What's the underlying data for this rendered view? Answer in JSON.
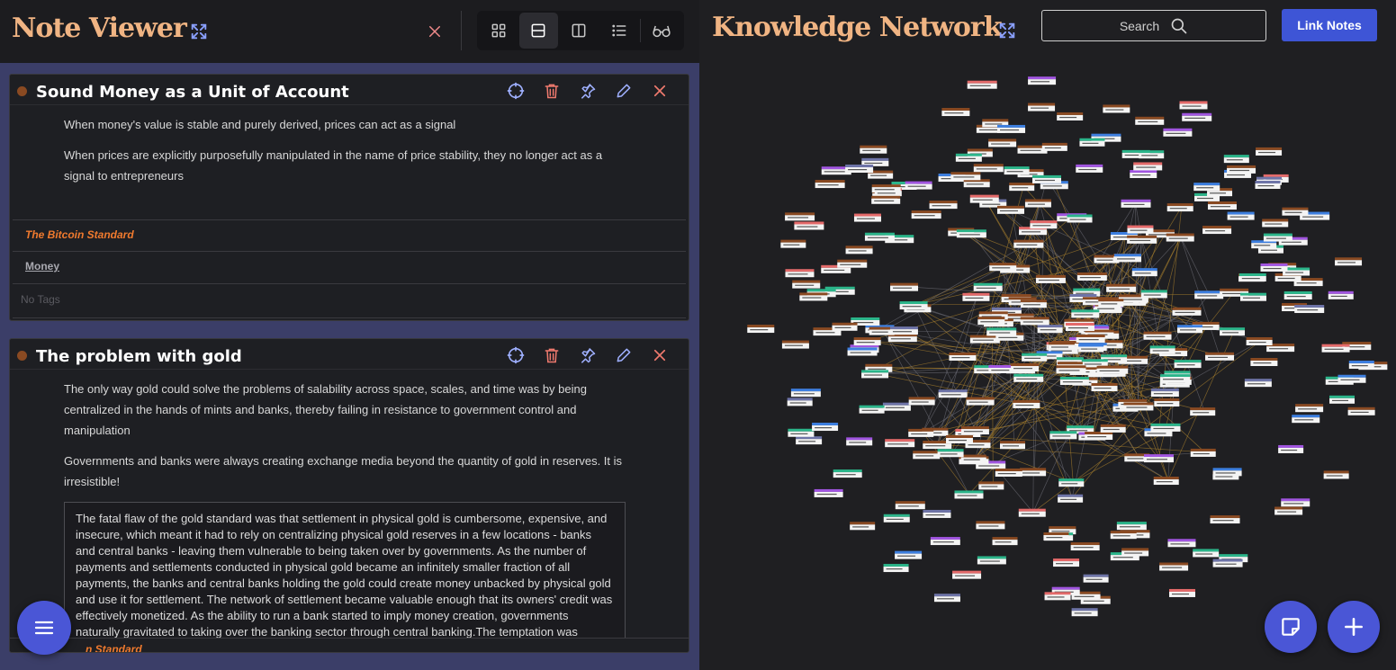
{
  "note_viewer": {
    "title": "Note Viewer",
    "view_modes": [
      "grid-view-icon",
      "stacked-view-icon",
      "split-view-icon",
      "list-view-icon",
      "reading-glasses-icon"
    ],
    "active_view": "stacked-view-icon"
  },
  "notes": [
    {
      "title": "Sound Money as a Unit of Account",
      "paragraphs": [
        "When money's value is stable and purely derived, prices can act as a signal",
        "When prices are explicitly purposefully manipulated in the name of price stability, they no longer act as a signal to entrepreneurs"
      ],
      "book": "The Bitcoin Standard",
      "topic": "Money",
      "tags": "No Tags"
    },
    {
      "title": "The problem with gold",
      "paragraphs": [
        "The only way gold could solve the problems of salability across space, scales, and time was by being centralized in the hands of mints and banks, thereby failing in resistance to government control and manipulation",
        "Governments and banks were always creating exchange media beyond the quantity of gold in reserves. It is irresistible!"
      ],
      "quote": "The fatal flaw of the gold standard was that settlement in physical gold is cumbersome, expensive, and insecure, which meant it had to rely on centralizing physical gold reserves in a few locations - banks and central banks - leaving them vulnerable to being taken over by governments. As the number of payments and settlements conducted in physical gold became an infinitely smaller fraction of all payments, the banks and central banks holding the gold could create money unbacked by physical gold and use it for settlement. The network of settlement became valuable enough that its owners' credit was effectively monetized. As the ability to run a bank started to imply money creation, governments naturally gravitated to taking over the banking sector through central banking.The temptation was",
      "book_partial": "n Standard"
    }
  ],
  "knowledge_network": {
    "title": "Knowledge Network",
    "search_placeholder": "Search",
    "link_button": "Link Notes"
  },
  "colors": {
    "accent": "#4a56d6",
    "title_orange": "#f0b483",
    "book_orange": "#f07a2e",
    "node_brown": "#8a4a22",
    "node_green": "#2bb58a",
    "node_blue": "#3d7fe0",
    "node_purple": "#a155e0",
    "node_red": "#e46a6a",
    "node_slate": "#6e74a8"
  }
}
